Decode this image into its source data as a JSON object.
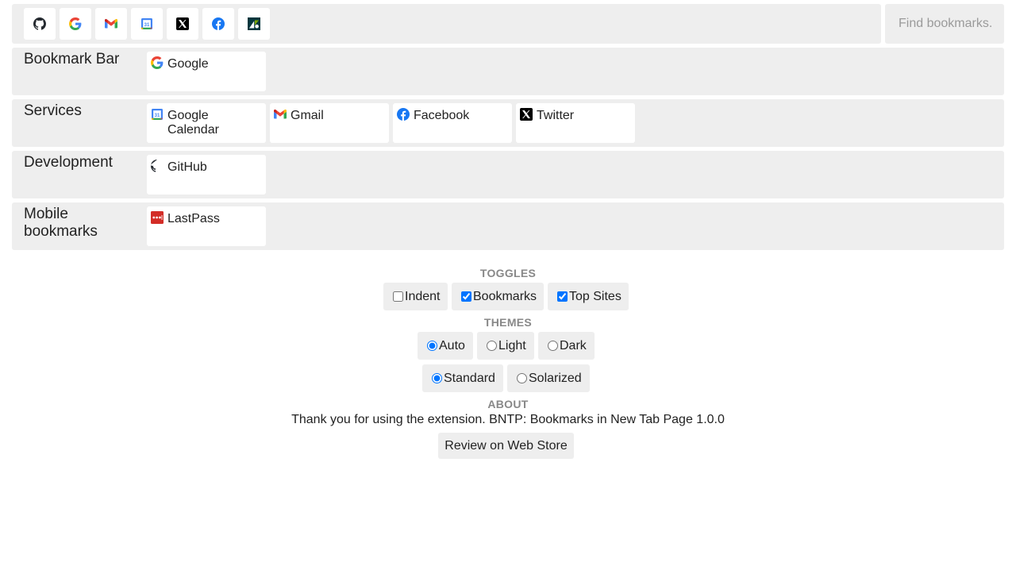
{
  "top_sites": [
    {
      "name": "GitHub",
      "icon": "github-icon"
    },
    {
      "name": "Google",
      "icon": "google-icon"
    },
    {
      "name": "Gmail",
      "icon": "gmail-icon"
    },
    {
      "name": "Google Calendar",
      "icon": "google-calendar-icon"
    },
    {
      "name": "Twitter",
      "icon": "x-twitter-icon"
    },
    {
      "name": "Facebook",
      "icon": "facebook-icon"
    },
    {
      "name": "Zendesk",
      "icon": "zendesk-icon"
    }
  ],
  "search": {
    "placeholder": "Find bookmarks..."
  },
  "folders": [
    {
      "title": "Bookmark Bar",
      "bookmarks": [
        {
          "label": "Google",
          "icon": "google-icon"
        }
      ]
    },
    {
      "title": "Services",
      "bookmarks": [
        {
          "label": "Google Calendar",
          "icon": "google-calendar-icon"
        },
        {
          "label": "Gmail",
          "icon": "gmail-icon"
        },
        {
          "label": "Facebook",
          "icon": "facebook-icon"
        },
        {
          "label": "Twitter",
          "icon": "x-twitter-icon"
        }
      ]
    },
    {
      "title": "Development",
      "bookmarks": [
        {
          "label": "GitHub",
          "icon": "github-icon"
        }
      ]
    },
    {
      "title": "Mobile bookmarks",
      "bookmarks": [
        {
          "label": "LastPass",
          "icon": "lastpass-icon"
        }
      ]
    }
  ],
  "toggles": {
    "heading": "TOGGLES",
    "items": [
      {
        "label": "Indent",
        "checked": false
      },
      {
        "label": "Bookmarks",
        "checked": true
      },
      {
        "label": "Top Sites",
        "checked": true
      }
    ]
  },
  "themes": {
    "heading": "THEMES",
    "mode_options": [
      {
        "label": "Auto",
        "selected": true
      },
      {
        "label": "Light",
        "selected": false
      },
      {
        "label": "Dark",
        "selected": false
      }
    ],
    "palette_options": [
      {
        "label": "Standard",
        "selected": true
      },
      {
        "label": "Solarized",
        "selected": false
      }
    ]
  },
  "about": {
    "heading": "ABOUT",
    "text": "Thank you for using the extension. BNTP: Bookmarks in New Tab Page 1.0.0",
    "review_label": "Review on Web Store"
  },
  "colors": {
    "panel_bg": "#eeeeee",
    "tile_bg": "#ffffff",
    "heading_gray": "#888888",
    "placeholder_gray": "#9a9a9a"
  }
}
